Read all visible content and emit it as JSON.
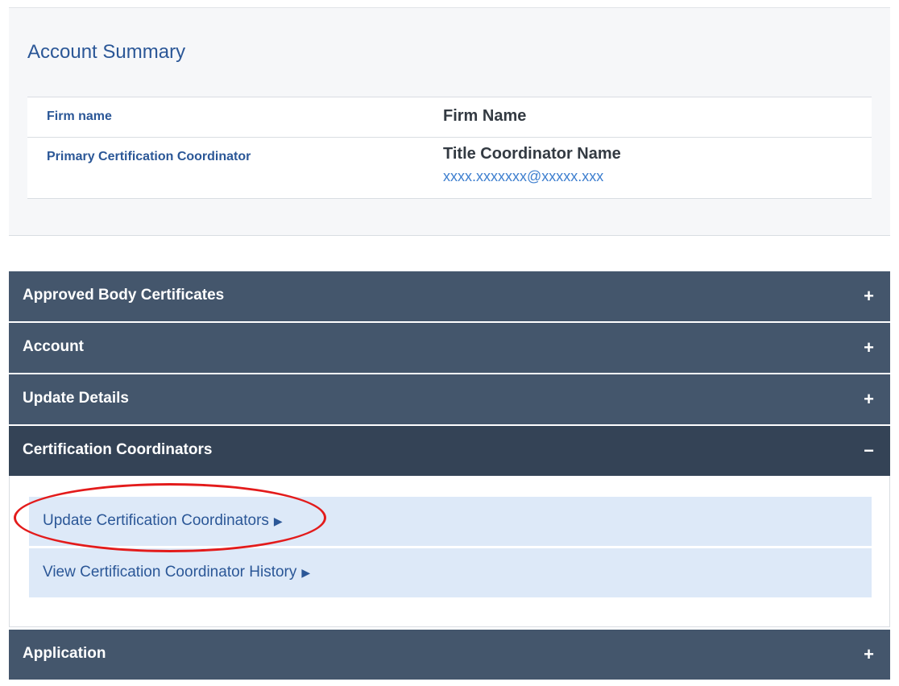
{
  "summary": {
    "title": "Account Summary",
    "rows": [
      {
        "label": "Firm name",
        "value": "Firm Name"
      },
      {
        "label": "Primary Certification Coordinator",
        "value": "Title Coordinator Name",
        "email": "xxxx.xxxxxxx@xxxxx.xxx"
      }
    ]
  },
  "accordion": [
    {
      "title": "Approved Body Certificates",
      "toggle": "+"
    },
    {
      "title": "Account",
      "toggle": "+"
    },
    {
      "title": "Update Details",
      "toggle": "+"
    },
    {
      "title": "Certification Coordinators",
      "toggle": "−"
    },
    {
      "title": "Application",
      "toggle": "+"
    }
  ],
  "coordinator_links": [
    {
      "label": "Update Certification Coordinators",
      "arrow": "▶"
    },
    {
      "label": "View Certification Coordinator History",
      "arrow": "▶"
    }
  ],
  "colors": {
    "header_bg": "#44566c",
    "header_open_bg": "#344356",
    "link_bg": "#dde9f8",
    "accent_blue": "#2b5797",
    "highlight": "#e31b1b"
  }
}
